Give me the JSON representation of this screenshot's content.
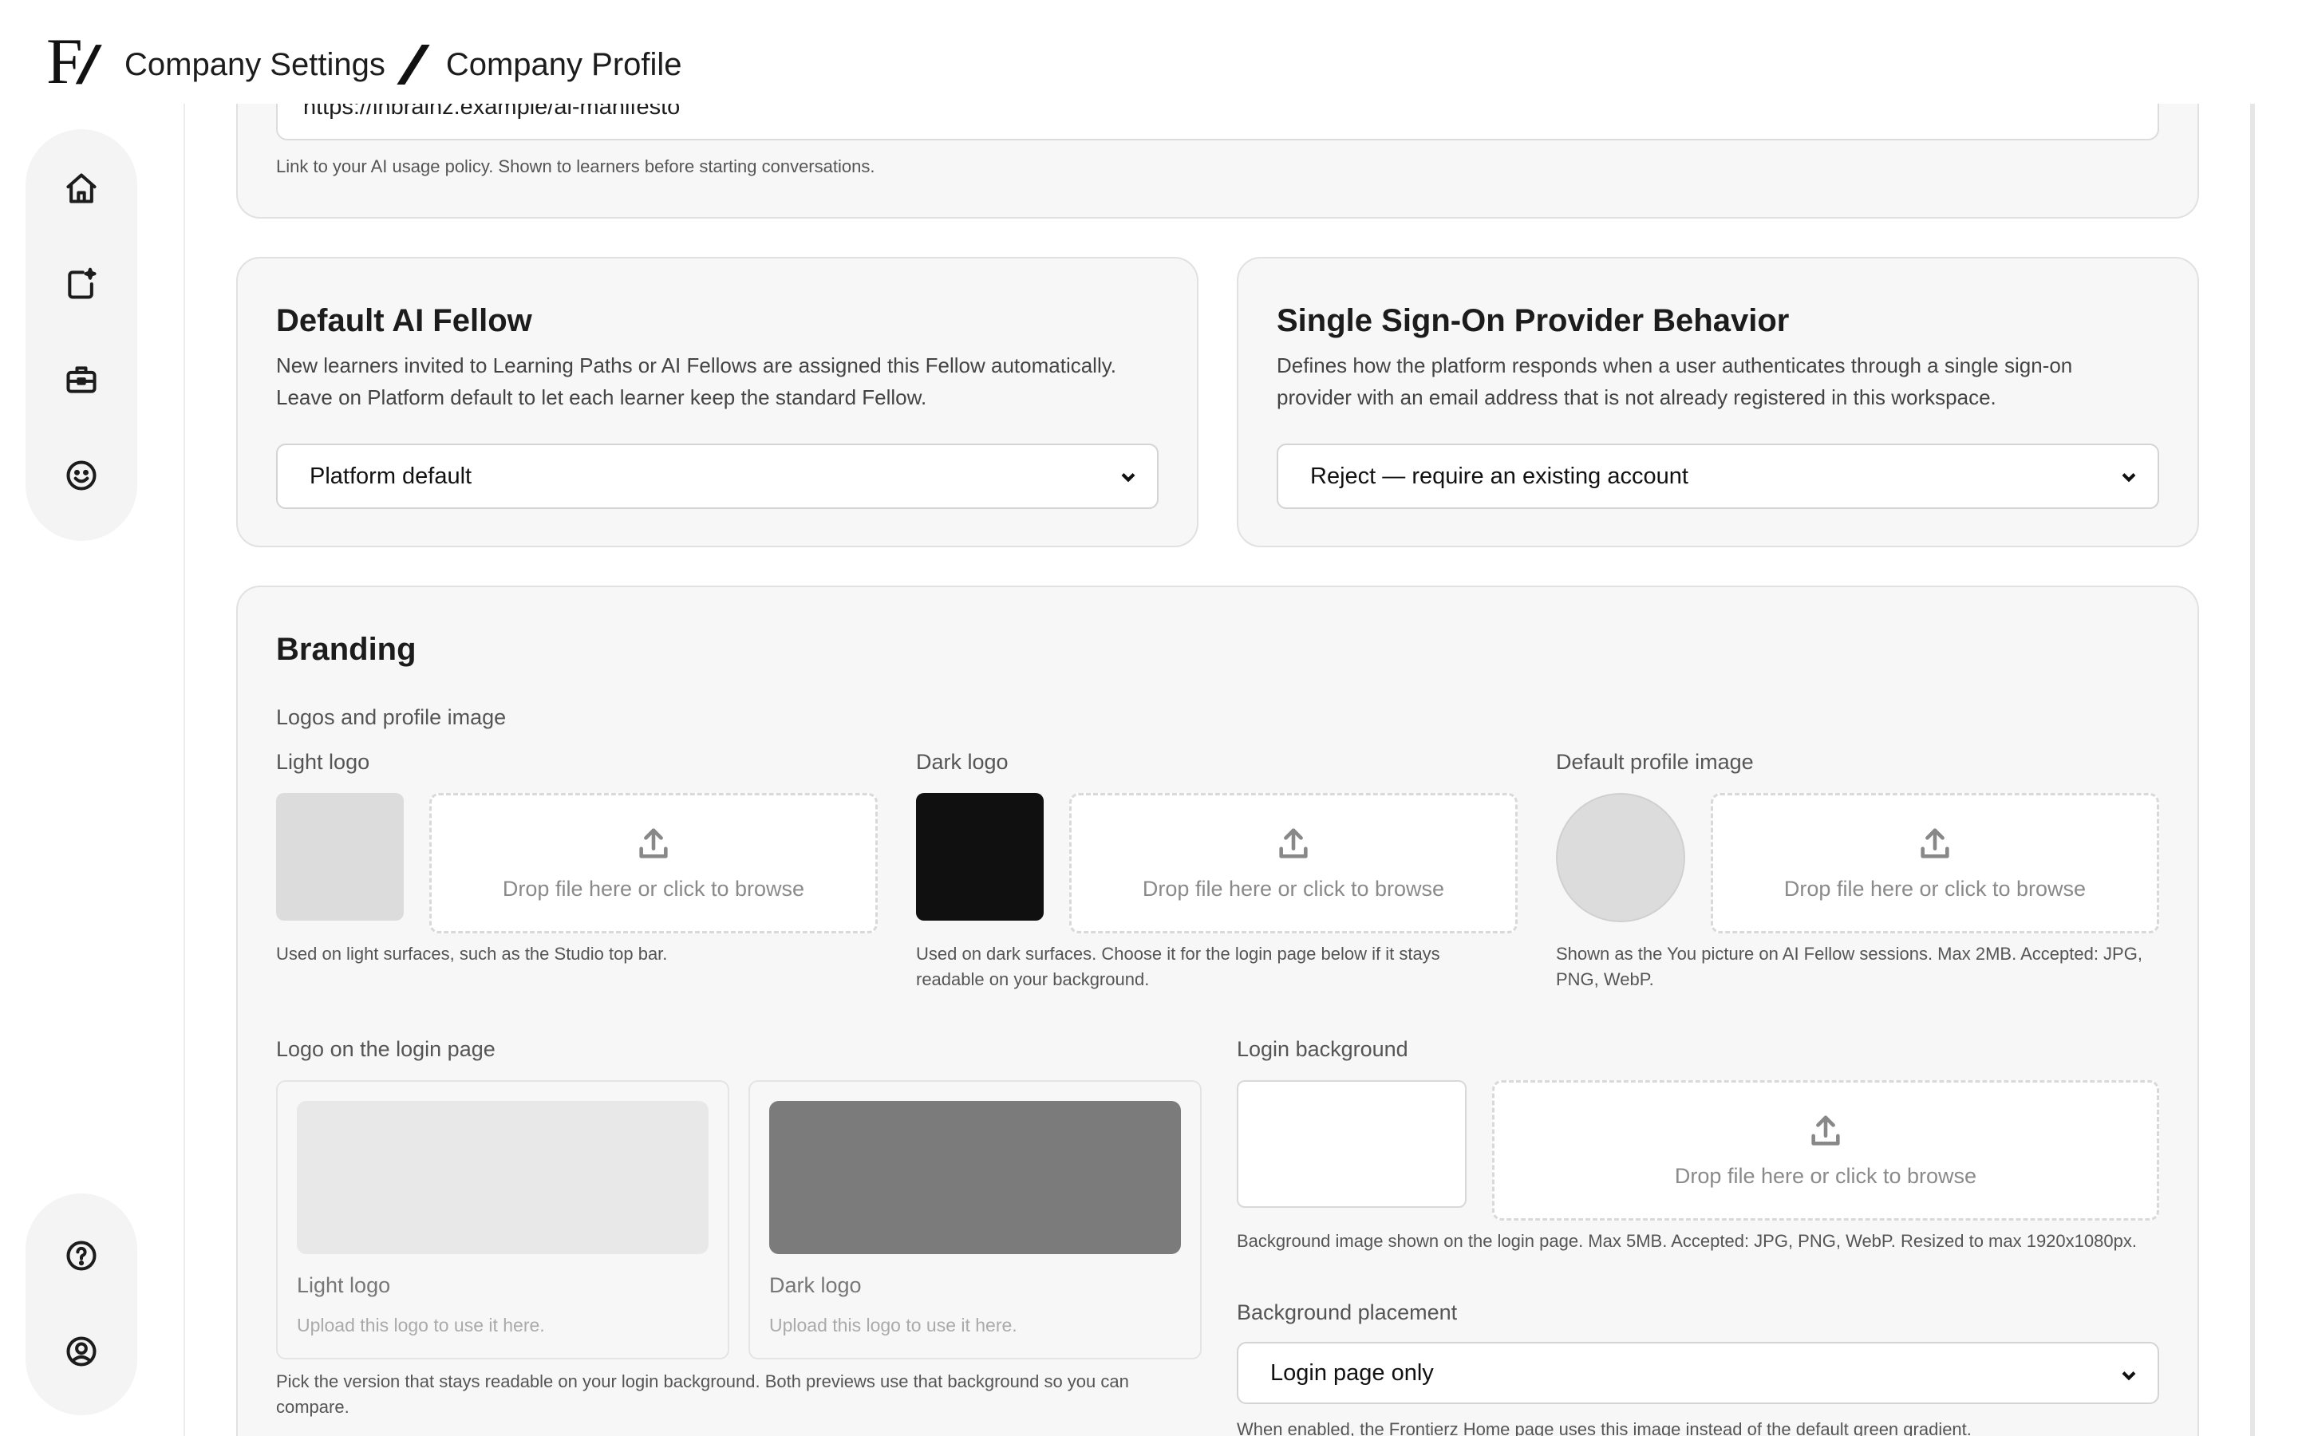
{
  "header": {
    "breadcrumb_root": "Company Settings",
    "breadcrumb_current": "Company Profile"
  },
  "nav": {
    "top_icons": [
      "home-icon",
      "new-conversation-icon",
      "briefcase-icon",
      "smiley-icon"
    ],
    "bottom_icons": [
      "help-icon",
      "account-icon"
    ]
  },
  "ai_policy": {
    "url_value": "https://inbrainz.example/ai-manifesto",
    "hint": "Link to your AI usage policy. Shown to learners before starting conversations."
  },
  "default_fellow": {
    "title": "Default AI Fellow",
    "description_line1": "New learners invited to Learning Paths or AI Fellows are assigned this Fellow automatically.",
    "description_line2": "Leave on Platform default to let each learner keep the standard Fellow.",
    "selected": "Platform default"
  },
  "sso": {
    "title": "Single Sign-On Provider Behavior",
    "description_line1": "Defines how the platform responds when a user authenticates through a single sign-on",
    "description_line2": "provider with an email address that is not already registered in this workspace.",
    "selected": "Reject — require an existing account"
  },
  "branding": {
    "title": "Branding",
    "section_label": "Logos and profile image",
    "dropzone_text": "Drop file here or click to browse",
    "light_logo": {
      "label": "Light logo",
      "hint": "Used on light surfaces, such as the Studio top bar."
    },
    "dark_logo": {
      "label": "Dark logo",
      "hint_line1": "Used on dark surfaces. Choose it for the login page below if it stays",
      "hint_line2": "readable on your background."
    },
    "profile_image": {
      "label": "Default profile image",
      "hint_line1": "Shown as the You picture on AI Fellow sessions. Max 2MB. Accepted: JPG,",
      "hint_line2": "PNG, WebP."
    },
    "login_logo": {
      "label": "Logo on the login page",
      "options": [
        {
          "name": "Light logo",
          "sub": "Upload this logo to use it here."
        },
        {
          "name": "Dark logo",
          "sub": "Upload this logo to use it here."
        }
      ],
      "hint_line1": "Pick the version that stays readable on your login background. Both previews use that background so you can",
      "hint_line2": "compare."
    },
    "login_background": {
      "label": "Login background",
      "hint": "Background image shown on the login page. Max 5MB. Accepted: JPG, PNG, WebP. Resized to max 1920x1080px."
    },
    "background_placement": {
      "label": "Background placement",
      "selected": "Login page only",
      "hint": "When enabled, the Frontierz Home page uses this image instead of the default green gradient."
    }
  },
  "colors": {
    "card_bg": "#f7f7f7",
    "border": "#e1e1e1",
    "dark_logo_fill": "#111010",
    "preview_dark": "#7b7b7b",
    "preview_light": "#e8e8e8"
  }
}
